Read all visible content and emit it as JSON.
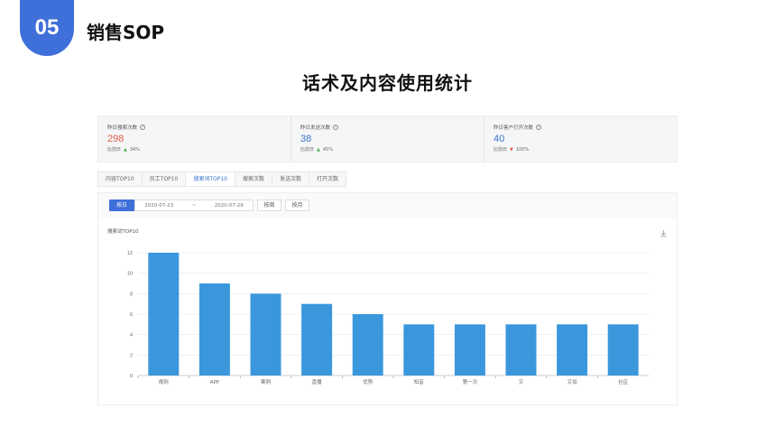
{
  "slide": {
    "badge_number": "05",
    "section_title": "销售SOP",
    "main_title": "话术及内容使用统计"
  },
  "stats": [
    {
      "label": "昨日搜索次数",
      "value": "298",
      "compare_label": "比前日",
      "compare_value": "34%",
      "trend": "up",
      "color": "#e05c4a"
    },
    {
      "label": "昨日发送次数",
      "value": "38",
      "compare_label": "比前日",
      "compare_value": "45%",
      "trend": "up",
      "color": "#3a74c9"
    },
    {
      "label": "昨日客户打开次数",
      "value": "40",
      "compare_label": "比前日",
      "compare_value": "100%",
      "trend": "down",
      "color": "#3a74c9"
    }
  ],
  "tabs": [
    {
      "label": "内容TOP10",
      "active": false
    },
    {
      "label": "员工TOP10",
      "active": false
    },
    {
      "label": "搜索词TOP10",
      "active": true
    },
    {
      "label": "搜索次数",
      "active": false
    },
    {
      "label": "发送次数",
      "active": false
    },
    {
      "label": "打开次数",
      "active": false
    }
  ],
  "filter": {
    "by_day_label": "按日",
    "date_start": "2020-07-23",
    "date_separator": "~",
    "date_end": "2020-07-29",
    "by_week_label": "按周",
    "by_month_label": "按月"
  },
  "chart_data": {
    "type": "bar",
    "title": "搜索词TOP10",
    "categories": [
      "规则",
      "APP",
      "案例",
      "直播",
      "优势",
      "知音",
      "第一次",
      "又",
      "又如",
      "社区"
    ],
    "values": [
      12,
      9,
      8,
      7,
      6,
      5,
      5,
      5,
      5,
      5
    ],
    "ylim": [
      0,
      12
    ],
    "yticks": [
      0,
      2,
      4,
      6,
      8,
      10,
      12
    ],
    "grid": true,
    "bar_color": "#3a97dc"
  },
  "icons": {
    "download": "download-icon",
    "help": "question-circle-icon"
  },
  "colors": {
    "accent": "#3f6fd9",
    "bar": "#3a97dc"
  }
}
